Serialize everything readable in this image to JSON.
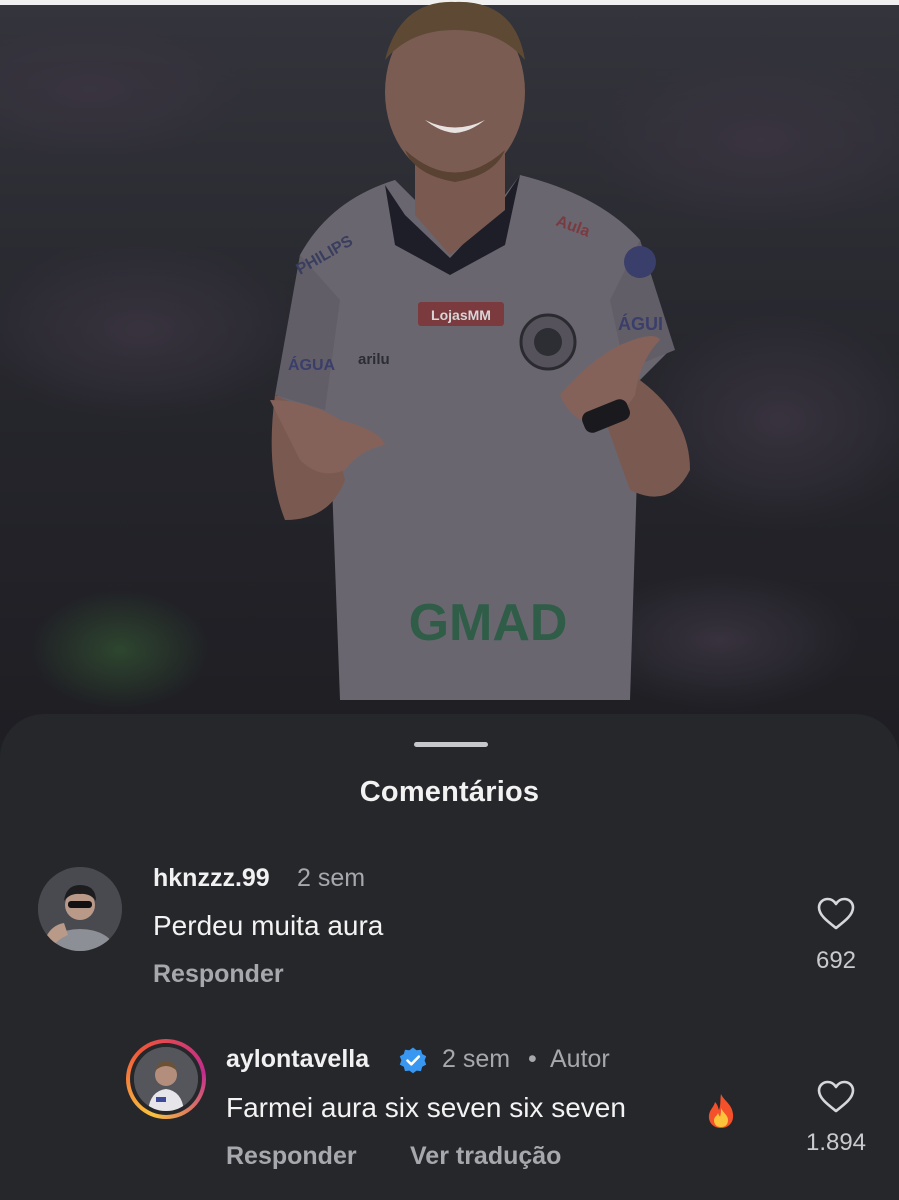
{
  "sheet": {
    "title": "Comentários"
  },
  "photo": {
    "sponsor_text": "GMAD",
    "sponsor_badge": "LojasMM"
  },
  "comments": [
    {
      "username": "hknzzz.99",
      "time": "2 sem",
      "text": "Perdeu muita aura",
      "reply_label": "Responder",
      "likes": "692",
      "avatar_icon": "profile-photo"
    },
    {
      "username": "aylontavella",
      "verified": true,
      "time": "2 sem",
      "separator": "•",
      "author_tag": "Autor",
      "text": "Farmei aura six seven six seven",
      "emoji_icon": "fire-icon",
      "reply_label": "Responder",
      "translate_label": "Ver tradução",
      "likes": "1.894",
      "avatar_icon": "profile-photo-story-ring"
    }
  ],
  "colors": {
    "sheet_bg": "#26272b",
    "text_primary": "#f1f1f1",
    "text_secondary": "#a7a8ad",
    "verified_blue": "#3897f0"
  }
}
